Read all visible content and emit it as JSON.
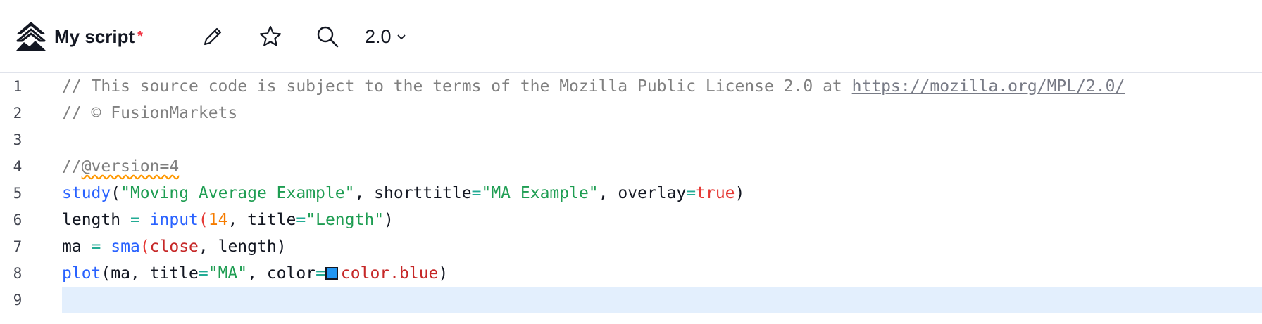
{
  "toolbar": {
    "script_name": "My script",
    "unsaved_marker": "*",
    "version": "2.0",
    "icons": {
      "logo": "pine-logo-icon",
      "edit": "pencil-icon",
      "favorite": "star-icon",
      "search": "search-icon",
      "dropdown": "chevron-down-icon"
    }
  },
  "editor": {
    "line_numbers": [
      "1",
      "2",
      "3",
      "4",
      "5",
      "6",
      "7",
      "8",
      "9"
    ],
    "current_line": "9",
    "lines": {
      "l1_comment": "// This source code is subject to the terms of the Mozilla Public License 2.0 at ",
      "l1_link": "https://mozilla.org/MPL/2.0/",
      "l2_comment": "// © FusionMarkets",
      "l4_prefix": "//",
      "l4_version": "@version=4",
      "l5_fn": "study",
      "l5_open": "(",
      "l5_str1": "\"Moving Average Example\"",
      "l5_sep1": ", shorttitle",
      "l5_eq1": "=",
      "l5_str2": "\"MA Example\"",
      "l5_sep2": ", overlay",
      "l5_eq2": "=",
      "l5_true": "true",
      "l5_close": ")",
      "l6_var": "length ",
      "l6_eq": "=",
      "l6_sp": " ",
      "l6_fn": "input",
      "l6_open": "(",
      "l6_num": "14",
      "l6_sep": ", title",
      "l6_eq2": "=",
      "l6_str": "\"Length\"",
      "l6_close": ")",
      "l7_var": "ma ",
      "l7_eq": "=",
      "l7_sp": " ",
      "l7_fn": "sma",
      "l7_open": "(",
      "l7_close_kw": "close",
      "l7_rest": ", length)",
      "l8_fn": "plot",
      "l8_args": "(ma, title",
      "l8_eq": "=",
      "l8_str": "\"MA\"",
      "l8_sep": ", color",
      "l8_eq2": "=",
      "l8_color": "color.blue",
      "l8_close": ")"
    },
    "colors": {
      "swatch": "#2196f3",
      "current_line_bg": "#e3effd"
    }
  }
}
